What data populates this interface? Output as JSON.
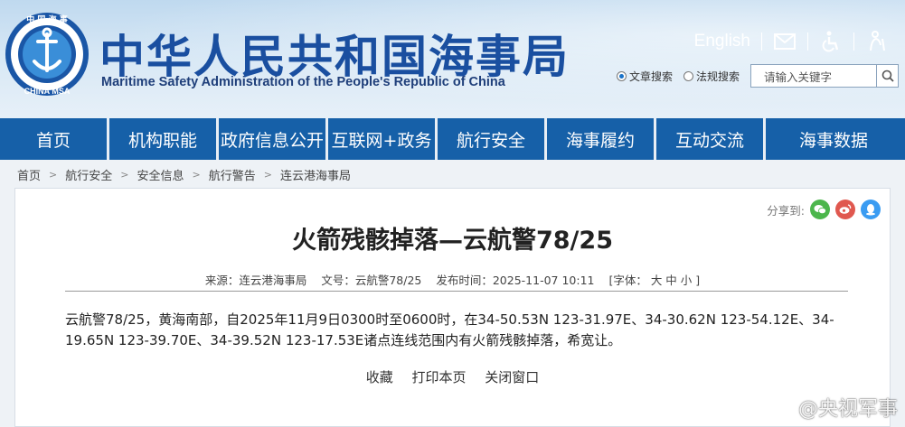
{
  "header": {
    "logo_text": "中国海事",
    "logo_sub": "CHINA MSA",
    "cn_title": "中华人民共和国海事局",
    "en_title": "Maritime Safety Administration of the People's Republic of China",
    "english_link": "English"
  },
  "search": {
    "option_article": "文章搜索",
    "option_law": "法规搜索",
    "placeholder": "请输入关键字"
  },
  "nav": [
    "首页",
    "机构职能",
    "政府信息公开",
    "互联网+政务",
    "航行安全",
    "海事履约",
    "互动交流",
    "海事数据"
  ],
  "breadcrumb": [
    "首页",
    "航行安全",
    "安全信息",
    "航行警告",
    "连云港海事局"
  ],
  "share": {
    "label": "分享到:"
  },
  "article": {
    "title": "火箭残骸掉落—云航警78/25",
    "source": "来源：连云港海事局",
    "doc_no": "文号：云航警78/25",
    "published": "发布时间：2025-11-07 10:11",
    "font_size": "[字体： 大  中  小 ]",
    "body": "云航警78/25，黄海南部，自2025年11月9日0300时至0600时，在34-50.53N 123-31.97E、34-30.62N 123-54.12E、34-19.65N 123-39.70E、34-39.52N 123-17.53E诸点连线范围内有火箭残骸掉落，希宽让。",
    "actions": [
      "收藏",
      "打印本页",
      "关闭窗口"
    ]
  },
  "watermark": "@央视军事",
  "colors": {
    "nav": "#1660a8",
    "title_blue": "#1a4fa0"
  }
}
